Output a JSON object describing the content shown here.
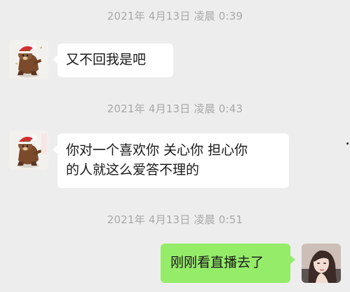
{
  "timestamps": [
    "2021年 4月13日 凌晨 0:39",
    "2021年 4月13日 凌晨 0:43",
    "2021年 4月13日 凌晨 0:51"
  ],
  "messages": [
    {
      "sender": "contact",
      "text": "又不回我是吧"
    },
    {
      "sender": "contact",
      "lines": [
        "你对一个喜欢你 关心你 担心你",
        "的人就这么爱答不理的"
      ]
    },
    {
      "sender": "self",
      "text": "刚刚看直播去了"
    }
  ],
  "avatars": {
    "contact": "brown-bear-christmas-hat-avatar",
    "self": "girl-portrait-avatar"
  },
  "colors": {
    "background": "#ededed",
    "timestamp_text": "#a8a8a8",
    "incoming_bubble": "#ffffff",
    "outgoing_bubble": "#95ec69",
    "message_text": "#191919"
  }
}
